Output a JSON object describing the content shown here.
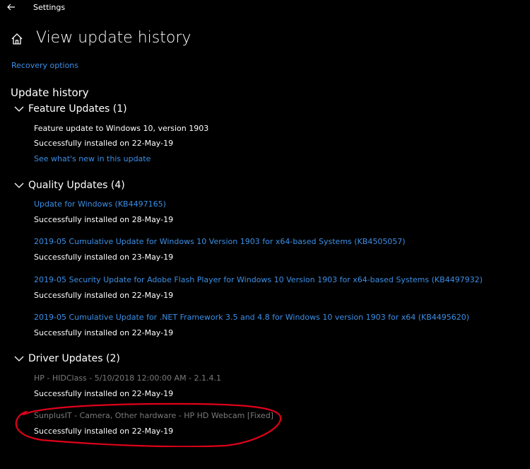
{
  "window": {
    "title": "Settings"
  },
  "page": {
    "title": "View update history"
  },
  "links": {
    "recovery": "Recovery options"
  },
  "history": {
    "title": "Update history",
    "categories": [
      {
        "label": "Feature Updates (1)",
        "items": [
          {
            "name": "Feature update to Windows 10, version 1903",
            "status": "Successfully installed on 22-May-19",
            "link": "See what's new in this update"
          }
        ]
      },
      {
        "label": "Quality Updates (4)",
        "items": [
          {
            "name": "Update for Windows (KB4497165)",
            "status": "Successfully installed on 28-May-19"
          },
          {
            "name": "2019-05 Cumulative Update for Windows 10 Version 1903 for x64-based Systems (KB4505057)",
            "status": "Successfully installed on 23-May-19"
          },
          {
            "name": "2019-05 Security Update for Adobe Flash Player for Windows 10 Version 1903 for x64-based Systems (KB4497932)",
            "status": "Successfully installed on 22-May-19"
          },
          {
            "name": "2019-05 Cumulative Update for .NET Framework 3.5 and 4.8 for Windows 10 version 1903 for x64 (KB4495620)",
            "status": "Successfully installed on 22-May-19"
          }
        ]
      },
      {
        "label": "Driver Updates (2)",
        "items": [
          {
            "name": "HP - HIDClass - 5/10/2018 12:00:00 AM - 2.1.4.1",
            "status": "Successfully installed on 22-May-19"
          },
          {
            "name": "SunplusIT - Camera, Other hardware - HP HD Webcam [Fixed]",
            "status": "Successfully installed on 22-May-19"
          }
        ]
      }
    ]
  },
  "colors": {
    "background": "#000000",
    "link": "#3b8fe6",
    "driver_name": "#7a7a7a",
    "annotation": "#e0001a"
  },
  "icons": {
    "back": "back-arrow-icon",
    "home": "home-icon",
    "expand": "chevron-down-icon"
  }
}
